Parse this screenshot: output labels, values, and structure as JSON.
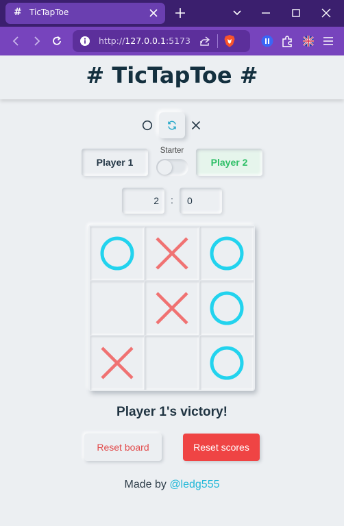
{
  "browser": {
    "tab_title": "TicTapToe",
    "tab_icon": "#",
    "url_prefix": "http://",
    "url_host": "127.0.0.1",
    "url_port": ":5173"
  },
  "page": {
    "title": "# TicTapToe #"
  },
  "players": {
    "player1": "Player 1",
    "player2": "Player 2",
    "starter_label": "Starter",
    "starter_symbol_left": "O",
    "starter_symbol_right": "X"
  },
  "scores": {
    "left": "2",
    "separator": ":",
    "right": "0"
  },
  "board": {
    "cells": [
      "O",
      "X",
      "O",
      "",
      "X",
      "O",
      "X",
      "",
      "O"
    ],
    "o_color": "#22d3ee",
    "x_color": "#f07272"
  },
  "status": {
    "message": "Player 1's victory!"
  },
  "buttons": {
    "reset_board": "Reset board",
    "reset_scores": "Reset scores"
  },
  "footer": {
    "made_by": "Made by",
    "author": "@ledg555"
  },
  "colors": {
    "accent_red": "#ef4444",
    "accent_green": "#2fbf67",
    "link": "#22b8d8",
    "browser_purple": "#7744bd"
  }
}
